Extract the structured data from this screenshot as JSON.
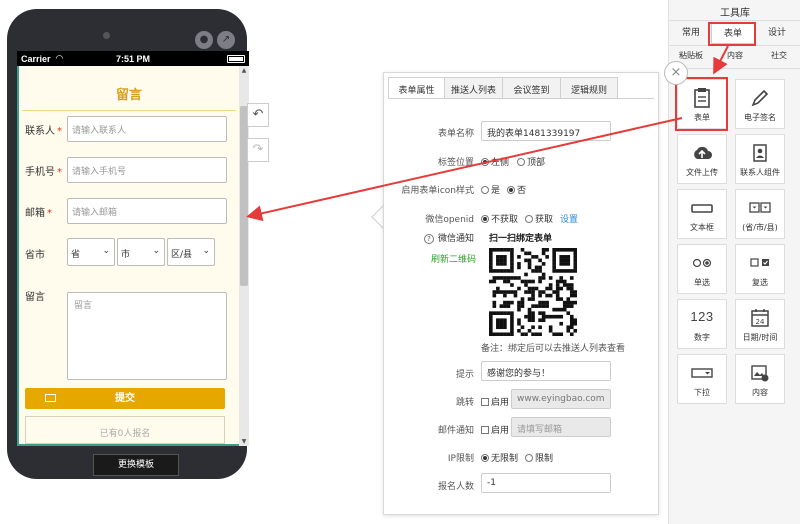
{
  "phone": {
    "status": {
      "carrier": "Carrier",
      "time": "7:51 PM"
    },
    "form": {
      "title": "留言",
      "contact": {
        "label": "联系人",
        "required": "*",
        "placeholder": "请输入联系人"
      },
      "mobile": {
        "label": "手机号",
        "required": "*",
        "placeholder": "请输入手机号"
      },
      "email": {
        "label": "邮箱",
        "required": "*",
        "placeholder": "请输入邮箱"
      },
      "region": {
        "label": "省市",
        "province": "省",
        "city": "市",
        "district": "区/县"
      },
      "message": {
        "label": "留言",
        "placeholder": "留言"
      },
      "submit_label": "提交",
      "signups_text": "已有0人报名"
    },
    "swap_template_label": "更换模板"
  },
  "editor": {
    "tabs": [
      "表单属性",
      "推送人列表",
      "会议签到",
      "逻辑规则"
    ],
    "form_name": {
      "label": "表单名称",
      "value": "我的表单1481339197"
    },
    "label_position": {
      "label": "标签位置",
      "options": [
        "左侧",
        "顶部"
      ],
      "selected": "左侧"
    },
    "enable_icon": {
      "label": "启用表单icon样式",
      "options": [
        "是",
        "否"
      ],
      "selected": "否"
    },
    "wechat_openid": {
      "label": "微信openid",
      "options": [
        "不获取",
        "获取"
      ],
      "selected": "不获取",
      "settings_link": "设置"
    },
    "wechat_notify": {
      "label": "微信通知",
      "help_icon": "?",
      "refresh_qr": "刷新二维码",
      "qr_title": "扫一扫绑定表单",
      "note": "备注：绑定后可以去推送人列表查看"
    },
    "prompt": {
      "label": "提示",
      "value": "感谢您的参与！"
    },
    "redirect": {
      "label": "跳转",
      "checkbox": "启用",
      "value": "www.eyingbao.com"
    },
    "mail_notify": {
      "label": "邮件通知",
      "checkbox": "启用",
      "placeholder": "请填写邮箱"
    },
    "ip_limit": {
      "label": "IP限制",
      "options": [
        "无限制",
        "限制"
      ],
      "selected": "无限制"
    },
    "signup_count": {
      "label": "报名人数",
      "value": "-1"
    }
  },
  "toolbox": {
    "title": "工具库",
    "tabs": [
      "常用",
      "表单",
      "设计"
    ],
    "active_tab": "表单",
    "subtabs": [
      "粘贴板",
      "内容",
      "社交"
    ],
    "widgets": [
      {
        "label": "表单",
        "icon": "form-icon"
      },
      {
        "label": "电子签名",
        "icon": "pen-icon"
      },
      {
        "label": "文件上传",
        "icon": "cloud-upload-icon"
      },
      {
        "label": "联系人组件",
        "icon": "contact-card-icon"
      },
      {
        "label": "文本框",
        "icon": "textbox-icon"
      },
      {
        "label": "(省/市/县)",
        "icon": "region-select-icon"
      },
      {
        "label": "单选",
        "icon": "radio-icon"
      },
      {
        "label": "复选",
        "icon": "checkbox-icon"
      },
      {
        "label": "数字",
        "icon": "number-icon",
        "glyph": "123"
      },
      {
        "label": "日期/时间",
        "icon": "calendar-icon",
        "glyph": "24"
      },
      {
        "label": "下拉",
        "icon": "dropdown-icon"
      },
      {
        "label": "内容",
        "icon": "content-icon"
      }
    ]
  },
  "colors": {
    "accent": "#e6a700",
    "title": "#d9a020",
    "highlight": "#e53b3b",
    "link": "#2a8ad8",
    "green": "#2ca22c",
    "frame": "#3b9d8b"
  }
}
